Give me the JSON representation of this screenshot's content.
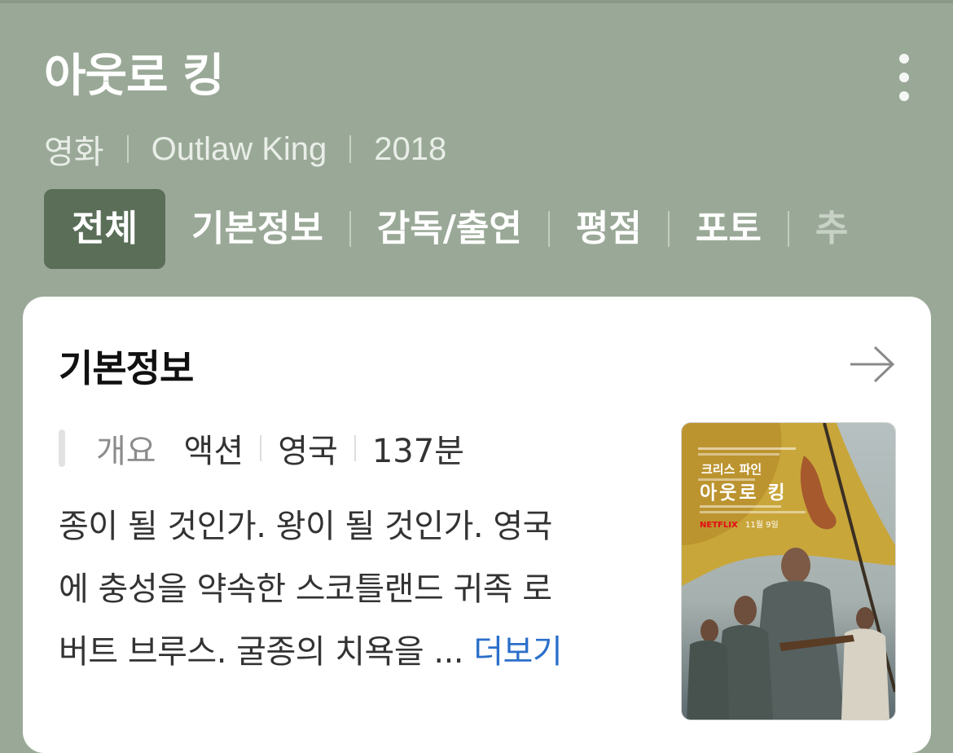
{
  "header": {
    "title": "아웃로 킹",
    "meta": [
      "영화",
      "Outlaw King",
      "2018"
    ]
  },
  "tabs": [
    {
      "label": "전체",
      "active": true
    },
    {
      "label": "기본정보",
      "active": false
    },
    {
      "label": "감독/출연",
      "active": false
    },
    {
      "label": "평점",
      "active": false
    },
    {
      "label": "포토",
      "active": false
    },
    {
      "label": "추",
      "active": false
    }
  ],
  "card": {
    "title": "기본정보",
    "overview_label": "개요",
    "tags": [
      "액션",
      "영국",
      "137분"
    ],
    "description": "종이 될 것인가. 왕이 될 것인가. 영국에 충성을 약속한 스코틀랜드 귀족 로버트 브루스. 굴종의 치욕을 ...",
    "description_lines": [
      "종이 될 것인가. 왕이 될 것인가. 영국",
      "에 충성을 약속한 스코틀랜드 귀족 로",
      "버트 브루스. 굴종의 치욕을 ..."
    ],
    "more_label": "더보기",
    "poster": {
      "actor": "크리스 파인",
      "title": "아웃로 킹",
      "brand": "NETFLIX",
      "date": "11월 9일"
    }
  },
  "colors": {
    "header_bg": "#9aa997",
    "active_tab": "#5a6e58",
    "link": "#2b6fca"
  },
  "icons": [
    "more-vertical-icon",
    "arrow-right-icon"
  ]
}
